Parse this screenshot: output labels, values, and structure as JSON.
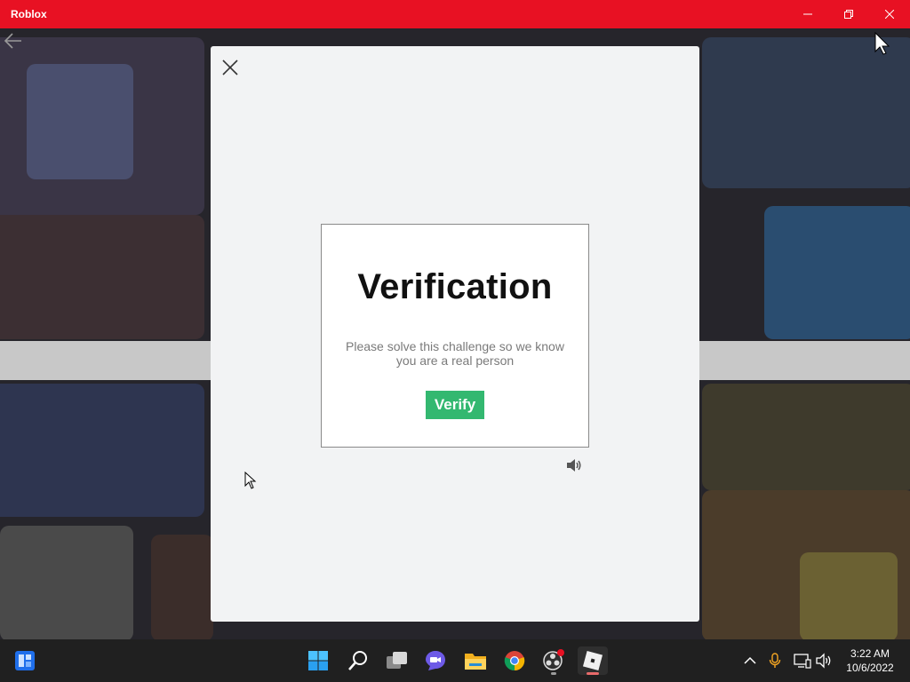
{
  "window": {
    "title": "Roblox",
    "accent": "#e81123",
    "controls": [
      "minimize-icon",
      "restore-icon",
      "close-icon"
    ]
  },
  "modal": {
    "close_icon": "close-icon",
    "heading": "Verification",
    "message": "Please solve this challenge so we know you are a real person",
    "verify_label": "Verify",
    "verify_color": "#33b870",
    "audio_icon": "speaker-icon"
  },
  "taskbar": {
    "apps": [
      "widgets-icon",
      "start-icon",
      "search-icon",
      "task-view-icon",
      "teams-chat-icon",
      "file-explorer-icon",
      "chrome-icon",
      "obs-icon",
      "roblox-icon"
    ],
    "tray": [
      "chevron-up-icon",
      "microphone-icon",
      "network-icon",
      "volume-icon"
    ],
    "time": "3:22 AM",
    "date": "10/6/2022"
  }
}
